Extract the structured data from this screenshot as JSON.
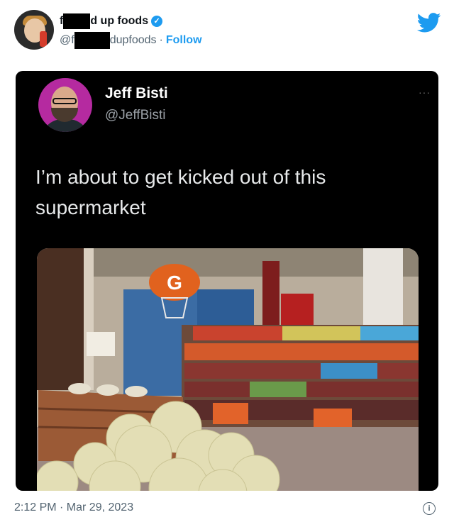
{
  "account": {
    "name_prefix": "f",
    "name_suffix": "d up foods",
    "handle_prefix": "@f",
    "handle_suffix": "dupfoods",
    "separator": "·",
    "follow_label": "Follow",
    "verified_icon": "verified-check-icon",
    "logo_icon": "twitter-bird-icon"
  },
  "tweet": {
    "author_name": "Jeff Bisti",
    "author_handle": "@JeffBisti",
    "more_label": "···",
    "text": "I’m about to get kicked out of this supermarket",
    "photo_sign": "G"
  },
  "footer": {
    "timestamp": "2:12 PM · Mar 29, 2023",
    "info_icon": "info-icon"
  },
  "colors": {
    "accent": "#1d9bf0",
    "card_bg": "#000000",
    "muted": "#536471"
  }
}
